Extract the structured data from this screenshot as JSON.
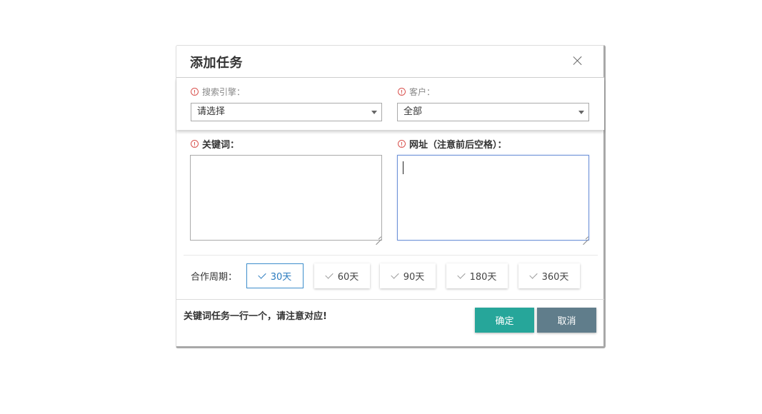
{
  "dialog": {
    "title": "添加任务",
    "close_icon": "close-icon"
  },
  "fields": {
    "search_engine": {
      "label": "搜索引擎：",
      "value": "请选择"
    },
    "client": {
      "label": "客户：",
      "value": "全部"
    },
    "keywords": {
      "label": "关键词：",
      "value": ""
    },
    "url": {
      "label": "网址（注意前后空格）：",
      "value": ""
    }
  },
  "cooperation_period": {
    "label": "合作周期：",
    "options": [
      {
        "label": "30天",
        "selected": true
      },
      {
        "label": "60天",
        "selected": false
      },
      {
        "label": "90天",
        "selected": false
      },
      {
        "label": "180天",
        "selected": false
      },
      {
        "label": "360天",
        "selected": false
      }
    ]
  },
  "footer": {
    "note": "关键词任务一行一个，请注意对应!",
    "confirm_label": "确定",
    "cancel_label": "取消"
  },
  "colors": {
    "required_icon": "#d9534f",
    "selected_option": "#3c8dcb",
    "confirm_bg": "#26a69a",
    "cancel_bg": "#607d8b"
  }
}
